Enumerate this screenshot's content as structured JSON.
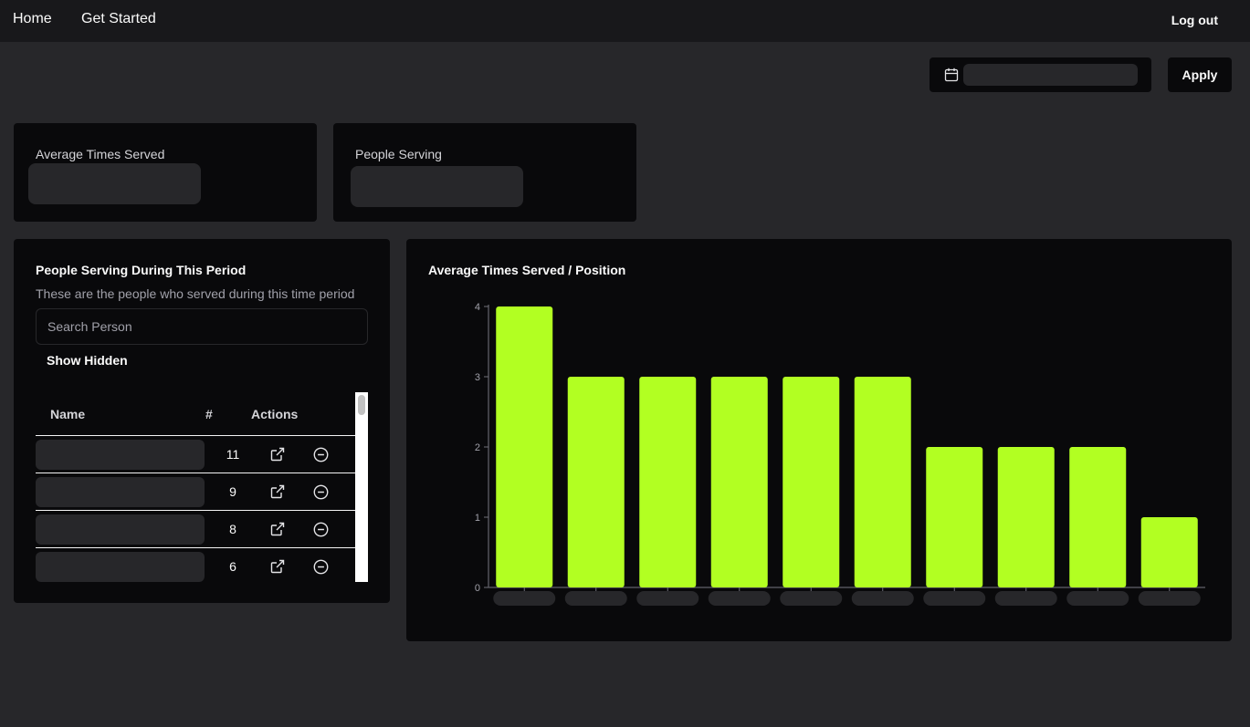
{
  "nav": {
    "home": "Home",
    "get_started": "Get Started",
    "logout": "Log out"
  },
  "toolbar": {
    "date_icon": "calendar-icon",
    "apply_label": "Apply"
  },
  "stats": {
    "avg_label": "Average Times Served",
    "people_label": "People Serving"
  },
  "people_panel": {
    "title": "People Serving During This Period",
    "subtitle": "These are the people who served during this time period",
    "search_placeholder": "Search Person",
    "show_hidden": "Show Hidden",
    "columns": [
      "Name",
      "#",
      "Actions"
    ],
    "rows": [
      {
        "count": "11"
      },
      {
        "count": "9"
      },
      {
        "count": "8"
      },
      {
        "count": "6"
      }
    ],
    "row_icons": [
      "external-link-icon",
      "minus-circle-icon"
    ]
  },
  "chart_panel": {
    "title": "Average Times Served / Position"
  },
  "colors": {
    "accent": "#b2ff22",
    "background": "#27272a",
    "card": "#09090b",
    "navbar": "#18181b"
  },
  "chart_data": {
    "type": "bar",
    "title": "Average Times Served / Position",
    "values": [
      4,
      3,
      3,
      3,
      3,
      3,
      2,
      2,
      2,
      1
    ],
    "ylim": [
      0,
      4
    ],
    "yticks": [
      "0",
      "1",
      "2",
      "3",
      "4"
    ],
    "grid": false,
    "color": "#b2ff22"
  }
}
